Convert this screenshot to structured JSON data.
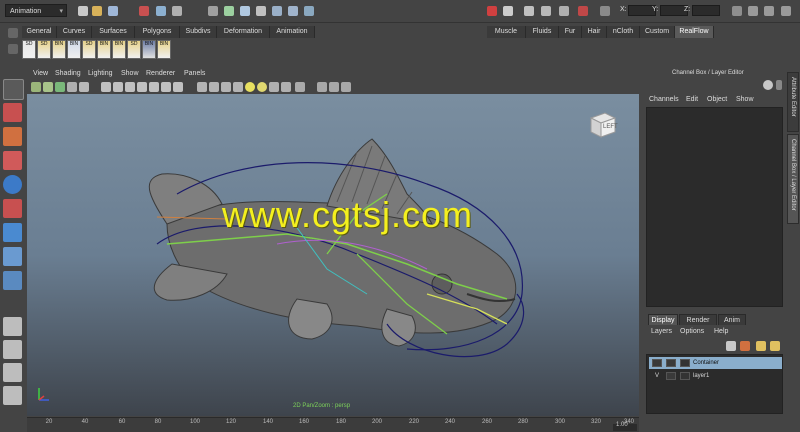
{
  "status_line": {
    "mode": "Animation",
    "coord_labels": [
      "X:",
      "Y:",
      "Z:"
    ]
  },
  "shelf": {
    "tabs": [
      "General",
      "Curves",
      "Surfaces",
      "Polygons",
      "Subdivs",
      "Deformation",
      "Animation",
      "Muscle",
      "Fluids",
      "Fur",
      "Hair",
      "nCloth",
      "Custom",
      "RealFlow"
    ],
    "active_tab": "RealFlow",
    "buttons": [
      "SD",
      "SD",
      "BIN",
      "BIN",
      "SD",
      "BIN",
      "BIN",
      "SD",
      "BIN",
      "BIN"
    ]
  },
  "panel": {
    "menu": [
      "View",
      "Shading",
      "Lighting",
      "Show",
      "Renderer",
      "Panels"
    ],
    "viewcube_label": "LEFT",
    "hud_text": "2D Pan/Zoom : persp",
    "watermark": "www.cgtsj.com"
  },
  "timeline": {
    "ticks": [
      "20",
      "40",
      "60",
      "80",
      "100",
      "120",
      "140",
      "160",
      "180",
      "200",
      "220",
      "240",
      "260",
      "280",
      "300",
      "320",
      "340"
    ],
    "range_value": "1.00"
  },
  "channel_box": {
    "title": "Channel Box / Layer Editor",
    "menu": [
      "Channels",
      "Edit",
      "Object",
      "Show"
    ]
  },
  "layer_editor": {
    "tabs": [
      "Display",
      "Render",
      "Anim"
    ],
    "active_tab": "Display",
    "menu": [
      "Layers",
      "Options",
      "Help"
    ],
    "layers": [
      {
        "visible": "",
        "name": "Container"
      },
      {
        "visible": "V",
        "name": "layer1"
      }
    ]
  },
  "side_tabs": [
    "Attribute Editor",
    "Channel Box / Layer Editor"
  ],
  "colors": {
    "ui_bg": "#444444",
    "viewport_top": "#7a8ea0",
    "viewport_bottom": "#3e444c",
    "selection": "#8aaecc",
    "watermark": "#f4f01e",
    "hud": "#7dd25a"
  }
}
